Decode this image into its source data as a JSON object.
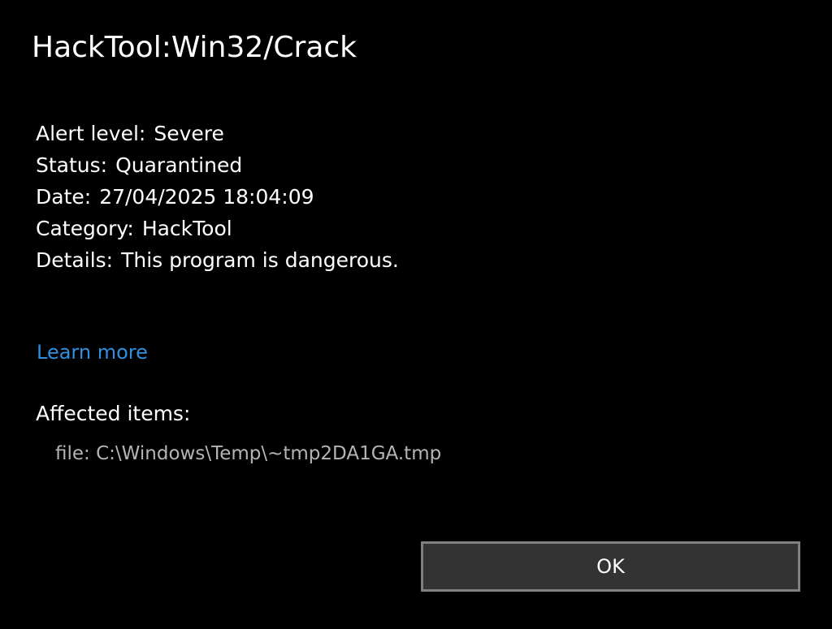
{
  "dialog": {
    "title": "HackTool:Win32/Crack",
    "details": [
      {
        "label": "Alert level:",
        "value": "Severe"
      },
      {
        "label": "Status:",
        "value": "Quarantined"
      },
      {
        "label": "Date:",
        "value": "27/04/2025 18:04:09"
      },
      {
        "label": "Category:",
        "value": "HackTool"
      },
      {
        "label": "Details:",
        "value": "This program is dangerous."
      }
    ],
    "learn_more": "Learn more",
    "affected_label": "Affected items:",
    "affected_items": [
      "file: C:\\Windows\\Temp\\~tmp2DA1GA.tmp"
    ],
    "ok_label": "OK"
  },
  "colors": {
    "background": "#000000",
    "text": "#ffffff",
    "link": "#2f8fe0",
    "muted_text": "#b4b4b4",
    "button_bg": "#333333",
    "button_border": "#808080"
  }
}
